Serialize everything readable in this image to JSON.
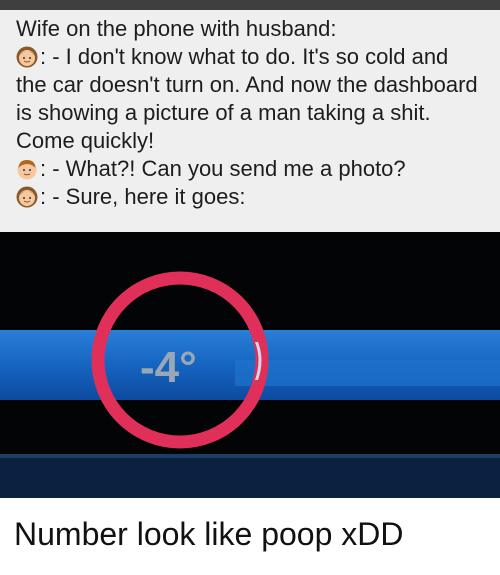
{
  "story": {
    "heading": "Wife on the phone with husband:",
    "messages": [
      {
        "speaker_icon": "woman-emoji",
        "lines": [
          ": - I don't know what to do. It's so cold and",
          "the car doesn't turn on. And now the dashboard",
          "is showing a picture of a man taking a shit.",
          "Come quickly!"
        ]
      },
      {
        "speaker_icon": "man-emoji",
        "lines": [
          ": - What?! Can you send me a photo?"
        ]
      },
      {
        "speaker_icon": "woman-emoji",
        "lines": [
          ": - Sure, here it goes:"
        ]
      }
    ]
  },
  "dashboard_photo": {
    "reading": "-4°",
    "circle_color": "#e0305a"
  },
  "caption": "Number look like poop xDD"
}
